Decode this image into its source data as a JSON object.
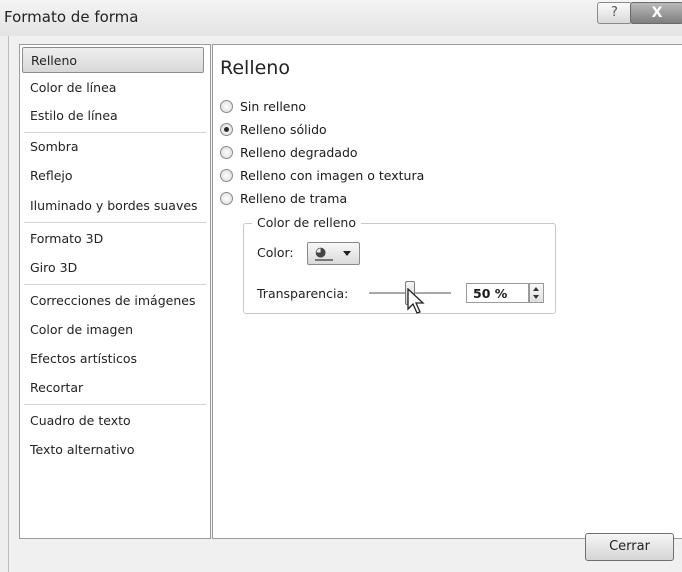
{
  "window": {
    "title": "Formato de forma",
    "help_label": "?",
    "close_label": "X"
  },
  "nav": {
    "items": [
      {
        "label": "Relleno",
        "selected": true
      },
      {
        "label": "Color de línea"
      },
      {
        "label": "Estilo de línea"
      },
      {
        "label": "Sombra"
      },
      {
        "label": "Reflejo"
      },
      {
        "label": "Iluminado y bordes suaves"
      },
      {
        "label": "Formato 3D"
      },
      {
        "label": "Giro 3D"
      },
      {
        "label": "Correcciones de imágenes"
      },
      {
        "label": "Color de imagen"
      },
      {
        "label": "Efectos artísticos"
      },
      {
        "label": "Recortar"
      },
      {
        "label": "Cuadro de texto"
      },
      {
        "label": "Texto alternativo"
      }
    ]
  },
  "panel": {
    "title": "Relleno",
    "fill_options": [
      {
        "label": "Sin relleno",
        "checked": false
      },
      {
        "label": "Relleno sólido",
        "checked": true
      },
      {
        "label": "Relleno degradado",
        "checked": false
      },
      {
        "label": "Relleno con imagen o textura",
        "checked": false
      },
      {
        "label": "Relleno de trama",
        "checked": false
      }
    ],
    "fill_color_group": {
      "legend": "Color de relleno",
      "color_label": "Color:",
      "color_icon": "paint-bucket-icon",
      "transparency_label": "Transparencia:",
      "transparency_value": "50 %",
      "transparency_percent": 50
    }
  },
  "footer": {
    "close_button_label": "Cerrar"
  }
}
